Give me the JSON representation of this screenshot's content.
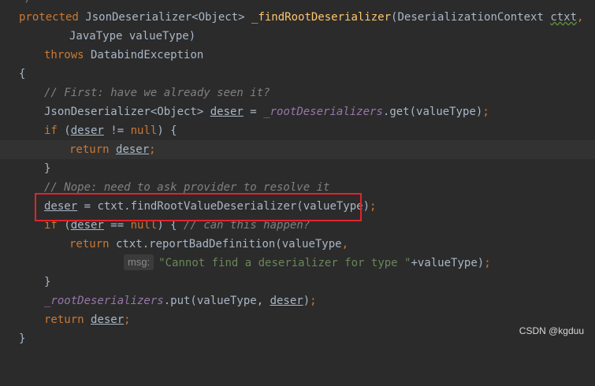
{
  "colors": {
    "background": "#2b2b2b",
    "keyword": "#cc7832",
    "method": "#ffc66d",
    "comment": "#808080",
    "string": "#6a8759",
    "field": "#9876aa",
    "highlight_box": "#e2232b"
  },
  "code": {
    "top_fragment": "*/",
    "l1_kw": "protected",
    "l1_type": " JsonDeserializer<Object> ",
    "l1_method": "_findRootDeserializer",
    "l1_params_a": "(DeserializationContext ",
    "l1_param_ctxt": "ctxt",
    "l1_params_b": ",",
    "l2": "JavaType valueType)",
    "l3_kw": "throws",
    "l3_rest": " DatabindException",
    "l4": "{",
    "l5_comment": "// First: have we already seen it?",
    "l6_type": "JsonDeserializer<Object> ",
    "l6_var": "deser",
    "l6_eq": " = ",
    "l6_field": "_rootDeserializers",
    "l6_call": ".get(valueType)",
    "l6_semi": ";",
    "l7_if": "if",
    "l7_open": " (",
    "l7_var": "deser",
    "l7_op": " != ",
    "l7_null": "null",
    "l7_close": ") {",
    "l8_ret": "return",
    "l8_sp": " ",
    "l8_var": "deser",
    "l8_semi": ";",
    "l9": "}",
    "l10_comment": "// Nope: need to ask provider to resolve it",
    "l11_var": "deser",
    "l11_rest": " = ctxt.findRootValueDeserializer(valueType)",
    "l11_semi": ";",
    "l12_if": "if",
    "l12_open": " (",
    "l12_var": "deser",
    "l12_op": " == ",
    "l12_null": "null",
    "l12_close": ") { ",
    "l12_comment": "// can this happen?",
    "l13_ret": "return",
    "l13_rest": " ctxt.reportBadDefinition(valueType",
    "l13_comma": ",",
    "l14_hint": "msg:",
    "l14_str": "\"Cannot find a deserializer for type \"",
    "l14_rest": "+valueType)",
    "l14_semi": ";",
    "l15": "}",
    "l16_field": "_rootDeserializers",
    "l16_call": ".put(valueType, ",
    "l16_var": "deser",
    "l16_close": ")",
    "l16_semi": ";",
    "l17_ret": "return",
    "l17_sp": " ",
    "l17_var": "deser",
    "l17_semi": ";",
    "l18": "}"
  },
  "watermark": "CSDN @kgduu"
}
